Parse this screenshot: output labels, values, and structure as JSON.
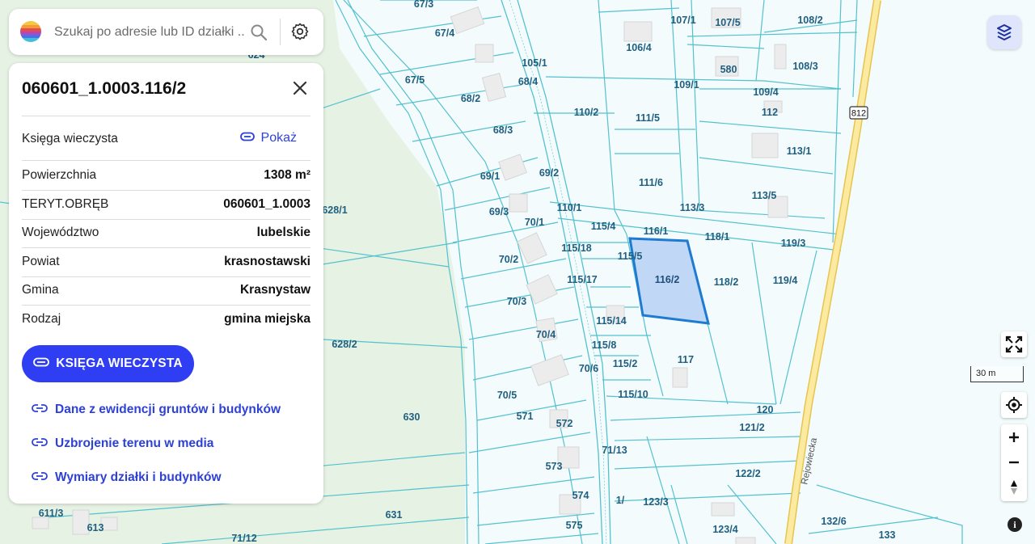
{
  "search": {
    "placeholder": "Szukaj po adresie lub ID działki ...",
    "icons": [
      "rainbow-logo-icon",
      "search-icon",
      "gear-icon"
    ]
  },
  "panel": {
    "title": "060601_1.0003.116/2",
    "kw_label": "Księga wieczysta",
    "kw_link": "Pokaż",
    "rows": [
      {
        "label": "Powierzchnia",
        "value": "1308 m²"
      },
      {
        "label": "TERYT.OBRĘB",
        "value": "060601_1.0003"
      },
      {
        "label": "Województwo",
        "value": "lubelskie"
      },
      {
        "label": "Powiat",
        "value": "krasnostawski"
      },
      {
        "label": "Gmina",
        "value": "Krasnystaw"
      },
      {
        "label": "Rodzaj",
        "value": "gmina miejska"
      }
    ],
    "button": "KSIĘGA WIECZYSTA",
    "links": [
      "Dane z ewidencji gruntów i budynków",
      "Uzbrojenie terenu w media",
      "Wymiary działki i budynków"
    ]
  },
  "map": {
    "scale_label": "30 m",
    "road_number": "812",
    "street_name": "Rejowiecka",
    "selected_parcel": "116/2",
    "colors": {
      "parcel_line": "#53c1cf",
      "green": "#e6f2e3",
      "selected_fill": "#b3cff3",
      "selected_stroke": "#1f7bd1",
      "road": "#f6e27a",
      "accent": "#2f3ef2"
    },
    "parcel_labels": [
      "67/3",
      "67/4",
      "67/5",
      "68/2",
      "68/3",
      "68/4",
      "69/1",
      "69/2",
      "69/3",
      "70/1",
      "70/2",
      "70/3",
      "70/4",
      "70/5",
      "70/6",
      "105/1",
      "106/4",
      "107/1",
      "107/5",
      "108/2",
      "108/3",
      "109/1",
      "109/4",
      "110/1",
      "110/2",
      "111/5",
      "111/6",
      "112",
      "113/1",
      "113/3",
      "113/5",
      "115/4",
      "115/5",
      "115/17",
      "115/18",
      "115/14",
      "115/8",
      "115/2",
      "115/10",
      "116/1",
      "116/2",
      "117",
      "118/1",
      "118/2",
      "119/3",
      "119/4",
      "120",
      "121/2",
      "122/2",
      "123/3",
      "123/4",
      "132/6",
      "133",
      "571",
      "572",
      "573",
      "574",
      "575",
      "580",
      "611/3",
      "613",
      "624",
      "628/1",
      "628/2",
      "630",
      "631",
      "71/12",
      "71/13",
      "1/"
    ]
  }
}
